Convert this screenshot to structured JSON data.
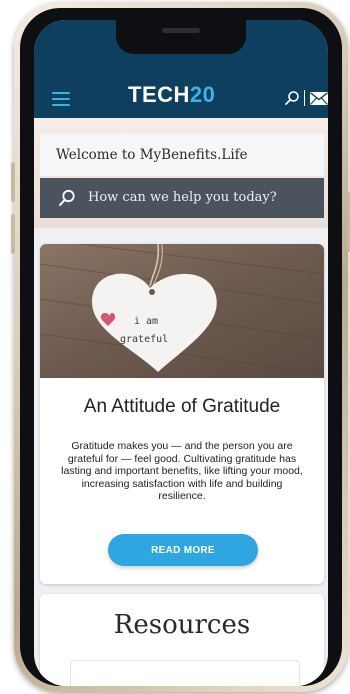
{
  "header": {
    "logo_main": "TECH",
    "logo_num": "20",
    "icons": [
      "hamburger-menu-icon",
      "search-icon",
      "mail-icon"
    ]
  },
  "hero": {
    "welcome_text": "Welcome to MyBenefits.Life",
    "search_placeholder": "How can we help you today?"
  },
  "article": {
    "image_text_line1": "i am",
    "image_text_line2": "grateful",
    "title": "An Attitude of Gratitude",
    "body": "Gratitude makes you — and the person you are grateful for — feel good. Cultivating gratitude has lasting and important benefits, like lifting your mood, increasing satisfaction with life and building resilience.",
    "button_label": "READ MORE"
  },
  "resources": {
    "title": "Resources"
  },
  "colors": {
    "header_bg": "#0f3f5f",
    "accent": "#3cb2e6",
    "button": "#2ea7e0",
    "search_bg": "#4b535e"
  }
}
